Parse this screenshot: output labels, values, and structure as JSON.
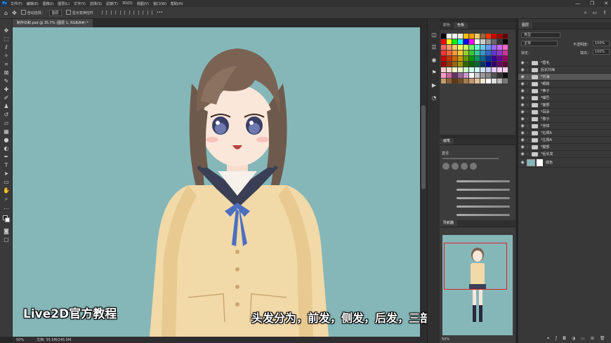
{
  "menubar": {
    "app_logo": "Ps",
    "items": [
      "文件(F)",
      "编辑(E)",
      "图像(I)",
      "图层(L)",
      "文字(Y)",
      "选择(S)",
      "滤镜(T)",
      "3D(D)",
      "视图(V)",
      "窗口(W)",
      "帮助(H)"
    ],
    "window_controls": [
      "—",
      "❐",
      "✕"
    ]
  },
  "options_bar": {
    "auto_select_label": "自动选择：",
    "auto_select_value": "图层",
    "show_transform_label": "显示变换控件",
    "more_label": "•••"
  },
  "document_tab": {
    "label": "制作日和.psd @ 35.7% (图层 1, RGB/8#) *"
  },
  "status_bar": {
    "zoom": "50%",
    "doc_info": "文档: 35.5M/245.5M"
  },
  "swatches_panel": {
    "tabs": [
      "颜色",
      "色板"
    ],
    "active_tab": "色板",
    "colors": [
      "#000000",
      "#ffffff",
      "#ffffff",
      "#eeeeee",
      "#f0c000",
      "#ff9900",
      "#ffcc66",
      "#996633",
      "#ff3300",
      "#cc0000",
      "#990000",
      "#660000",
      "#ff0000",
      "#ffff00",
      "#00ff00",
      "#00ffff",
      "#0000ff",
      "#ff00ff",
      "#ffffff",
      "#cccccc",
      "#999999",
      "#666666",
      "#333333",
      "#000000",
      "#ff6666",
      "#ff9966",
      "#ffcc66",
      "#ffff66",
      "#ccff66",
      "#66ff66",
      "#66ffcc",
      "#66ccff",
      "#6699ff",
      "#9966ff",
      "#cc66ff",
      "#ff66cc",
      "#ff3333",
      "#ff6633",
      "#ff9933",
      "#ffcc33",
      "#99cc33",
      "#33cc33",
      "#33cc99",
      "#3399cc",
      "#3366cc",
      "#6633cc",
      "#9933cc",
      "#cc3399",
      "#cc0000",
      "#cc3300",
      "#cc6600",
      "#cc9900",
      "#669900",
      "#009900",
      "#009966",
      "#006699",
      "#003399",
      "#330099",
      "#660099",
      "#990066",
      "#990000",
      "#993300",
      "#996600",
      "#999900",
      "#336600",
      "#006600",
      "#006633",
      "#003366",
      "#000099",
      "#330066",
      "#660066",
      "#660033",
      "#ffcccc",
      "#ffe0cc",
      "#ffffcc",
      "#e6ffcc",
      "#ccffcc",
      "#ccffe6",
      "#ccffff",
      "#cce6ff",
      "#ccccff",
      "#e6ccff",
      "#ffccff",
      "#ffcce6",
      "#ff99cc",
      "#cc6699",
      "#663366",
      "#996699",
      "#cc99cc",
      "#ffffff",
      "#cccccc",
      "#999999",
      "#888888",
      "#555555",
      "#333333",
      "#111111",
      "#c49a6c",
      "#8c6239",
      "#603913",
      "#754c24",
      "#a67c52",
      "#c69c6d",
      "#e0c39e",
      "#f5e6d0",
      "#ffffff",
      "#dddddd",
      "#bbbbbb",
      "#777777"
    ]
  },
  "brushes_panel": {
    "tab": "画笔",
    "search_label": "直径"
  },
  "navigator_panel": {
    "tab": "导航器",
    "zoom": "50%"
  },
  "layers_panel": {
    "tab": "图层",
    "search_placeholder": "类型",
    "blend_mode": "正常",
    "opacity_label": "不透明度：",
    "opacity_value": "100%",
    "lock_label": "锁定：",
    "fill_label": "填充：",
    "fill_value": "100%",
    "layers": [
      {
        "name": "*眉毛",
        "type": "folder",
        "selected": false
      },
      {
        "name": "后长刘海",
        "type": "folder",
        "selected": false
      },
      {
        "name": "*刘海",
        "type": "folder",
        "selected": true
      },
      {
        "name": "*眼睛",
        "type": "folder",
        "selected": false
      },
      {
        "name": "*鼻子",
        "type": "folder",
        "selected": false
      },
      {
        "name": "*嘴巴",
        "type": "folder",
        "selected": false
      },
      {
        "name": "*面部",
        "type": "folder",
        "selected": false
      },
      {
        "name": "*耳朵",
        "type": "folder",
        "selected": false
      },
      {
        "name": "*脖子",
        "type": "folder",
        "selected": false
      },
      {
        "name": "*身体",
        "type": "folder",
        "selected": false
      },
      {
        "name": "*右臂A",
        "type": "folder",
        "selected": false
      },
      {
        "name": "*左臂A",
        "type": "folder",
        "selected": false
      },
      {
        "name": "*腿部",
        "type": "folder",
        "selected": false
      },
      {
        "name": "*后长发",
        "type": "folder",
        "selected": false
      },
      {
        "name": "底色",
        "type": "layer",
        "selected": false
      }
    ]
  },
  "overlay": {
    "watermark": "Live2D官方教程",
    "subtitle": "头发分为，前发，侧发，后发，三部分"
  },
  "colors": {
    "canvas_bg": "#85b7b9",
    "accent": "#31a8ff"
  }
}
